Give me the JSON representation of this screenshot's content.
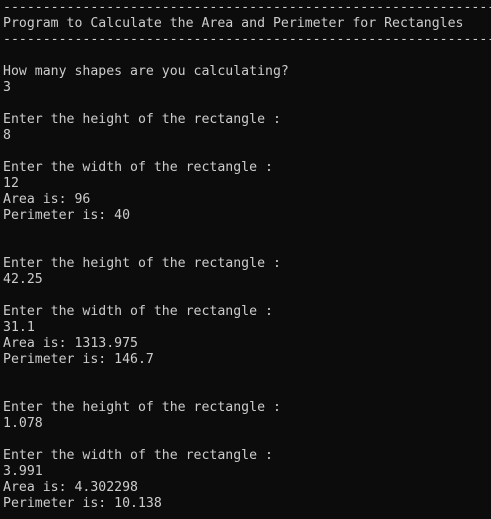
{
  "console": {
    "lines": [
      "--------------------------------------------------------------",
      "Program to Calculate the Area and Perimeter for Rectangles",
      "--------------------------------------------------------------",
      "",
      "How many shapes are you calculating?",
      "3",
      "",
      "Enter the height of the rectangle :",
      "8",
      "",
      "Enter the width of the rectangle :",
      "12",
      "Area is: 96",
      "Perimeter is: 40",
      "",
      "",
      "Enter the height of the rectangle :",
      "42.25",
      "",
      "Enter the width of the rectangle :",
      "31.1",
      "Area is: 1313.975",
      "Perimeter is: 146.7",
      "",
      "",
      "Enter the height of the rectangle :",
      "1.078",
      "",
      "Enter the width of the rectangle :",
      "3.991",
      "Area is: 4.302298",
      "Perimeter is: 10.138"
    ]
  },
  "colors": {
    "background": "#0c0c0c",
    "text": "#cccccc"
  }
}
